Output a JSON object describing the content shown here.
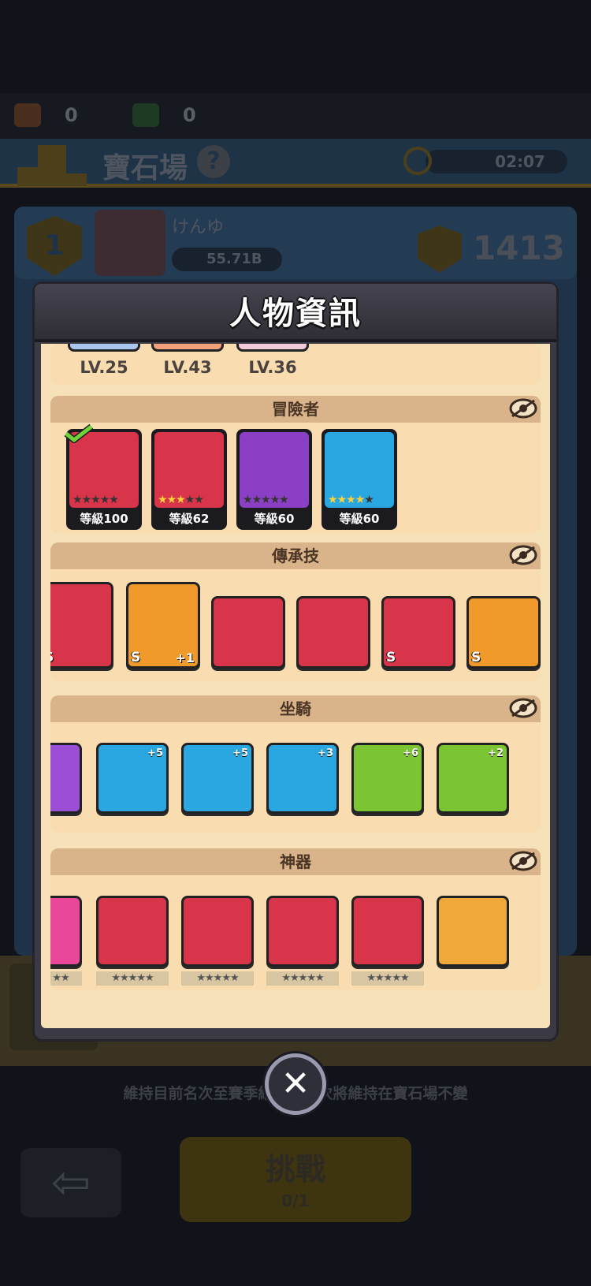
{
  "background": {
    "ticket_count": "0",
    "gem_count": "0",
    "arena_title": "寶石場",
    "help_label": "?",
    "timer": "02:07",
    "rank": "1",
    "player_name": "けんゆ",
    "player_power": "55.71B",
    "score": "1413",
    "notice": "維持目前名次至賽季結束，名次將維持在寶石場不變",
    "back_label": "⇦",
    "challenge_label": "挑戰",
    "challenge_tickets": "0/1"
  },
  "modal": {
    "title": "人物資訊",
    "levels": [
      "LV.25",
      "LV.43",
      "LV.36"
    ],
    "sections": {
      "adventurers": "冒險者",
      "legacy_skills": "傳承技",
      "mounts": "坐騎",
      "artifacts": "神器"
    },
    "adventurers": [
      {
        "level": "等級100",
        "stars": 5,
        "lit": 0,
        "color": "#d8344a"
      },
      {
        "level": "等級62",
        "stars": 5,
        "lit": 3,
        "color": "#d8344a"
      },
      {
        "level": "等級60",
        "stars": 5,
        "lit": 0,
        "color": "#8b3fc4"
      },
      {
        "level": "等級60",
        "stars": 5,
        "lit": 4,
        "color": "#2aa6e0"
      }
    ],
    "legacy_skills": [
      {
        "badge": "S",
        "plus": "",
        "color": "#d8344a"
      },
      {
        "badge": "S",
        "plus": "+1",
        "color": "#f09a2c"
      },
      {
        "badge": "",
        "plus": "",
        "color": "#d8344a"
      },
      {
        "badge": "",
        "plus": "",
        "color": "#d8344a"
      },
      {
        "badge": "S",
        "plus": "",
        "color": "#d8344a"
      },
      {
        "badge": "S",
        "plus": "",
        "color": "#f09a2c"
      }
    ],
    "mounts": [
      {
        "plus": "",
        "color": "#9b4fd6"
      },
      {
        "plus": "+5",
        "color": "#2aa6e0"
      },
      {
        "plus": "+5",
        "color": "#2aa6e0"
      },
      {
        "plus": "+3",
        "color": "#2aa6e0"
      },
      {
        "plus": "+6",
        "color": "#7cc532"
      },
      {
        "plus": "+2",
        "color": "#7cc532"
      }
    ],
    "artifacts": [
      {
        "stars": "★★",
        "color": "#e8479a"
      },
      {
        "stars": "★★★★★",
        "color": "#d8344a"
      },
      {
        "stars": "★★★★★",
        "color": "#d8344a"
      },
      {
        "stars": "★★★★★",
        "color": "#d8344a"
      },
      {
        "stars": "★★★★★",
        "color": "#d8344a"
      },
      {
        "stars": "",
        "color": "#f0a83a"
      }
    ],
    "close_label": "✕"
  }
}
